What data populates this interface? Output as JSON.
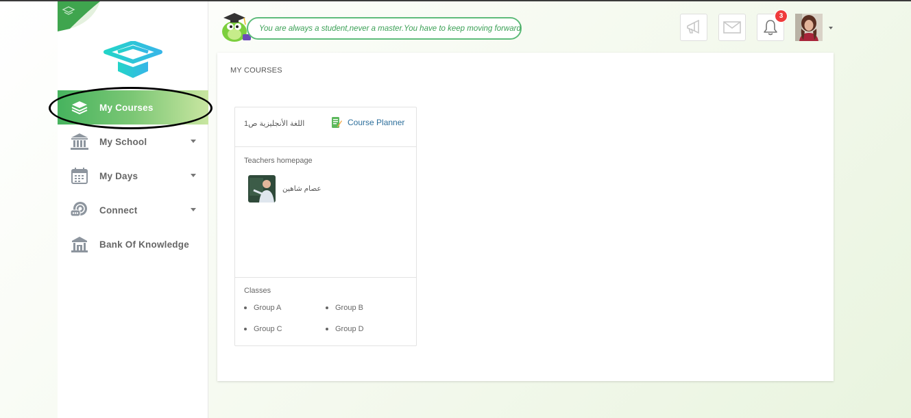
{
  "sidebar": {
    "items": [
      {
        "label": "My Courses",
        "icon": "layers-icon",
        "active": true
      },
      {
        "label": "My School",
        "icon": "school-building-icon",
        "has_submenu": true
      },
      {
        "label": "My Days",
        "icon": "calendar-icon",
        "has_submenu": true
      },
      {
        "label": "Connect",
        "icon": "chat-bubbles-icon",
        "has_submenu": true
      },
      {
        "label": "Bank Of Knowledge",
        "icon": "bank-icon"
      }
    ]
  },
  "header": {
    "quote": "You are always a student,never a master.You have to keep moving forward",
    "notifications_count": "3",
    "icons": [
      "megaphone-icon",
      "mail-icon",
      "bell-icon"
    ]
  },
  "main": {
    "title": "MY COURSES",
    "course": {
      "name": "اللغة الأنجليزية ص1",
      "planner_label": "Course Planner",
      "teachers_title": "Teachers homepage",
      "teacher_name": "عصام شاهين",
      "classes_title": "Classes",
      "classes": [
        "Group A",
        "Group B",
        "Group C",
        "Group D"
      ]
    }
  },
  "colors": {
    "accent_green": "#46b35e",
    "quote_border": "#5dbb7a",
    "link_blue": "#2c6e9b",
    "badge_red": "#ef3b3b"
  }
}
